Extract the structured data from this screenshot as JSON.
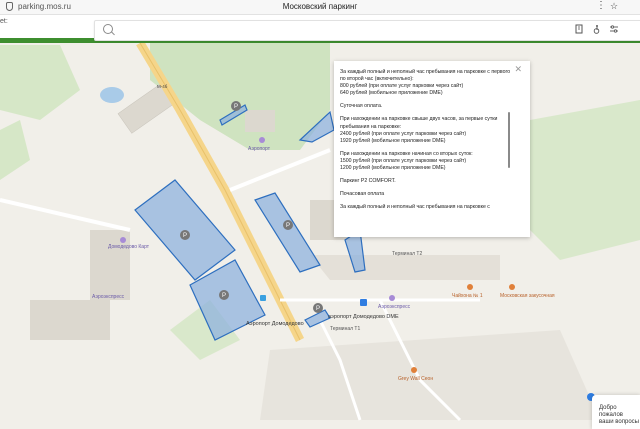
{
  "browser": {
    "url": "parking.mos.ru",
    "title": "Московский паркинг",
    "menu_glyph": "⋮",
    "star_glyph": "☆",
    "ext_text": "et:"
  },
  "search": {
    "placeholder": ""
  },
  "toolbar_icons": [
    "building-icon",
    "accessibility-icon",
    "filter-icon"
  ],
  "map_labels": {
    "domodedovo_karta": "Домодедово Карт",
    "aeroexpress_left": "Аэроэкспресс",
    "aeroport_domodedovo": "Аэропорт Домодедово",
    "aeroport_domodedovo_dme": "аэропорт Домодедово DME",
    "terminal_t1": "Терминал Т1",
    "terminal_t2": "Терминал Т2",
    "aeroexpress_right": "Аэроэкспресс",
    "chaykhona": "Чайхона № 1",
    "moskovskaya": "Московская закусочная",
    "grey_wall": "Grey Wall Сеон",
    "aeroport_top": "Аэропорт",
    "road_m4": "М-4б"
  },
  "popup": {
    "paragraphs": [
      [
        "За каждый полный и неполный час пребывания на парковке с первого по второй час (включительно):",
        "800 рублей (при оплате услуг парковки через сайт)",
        "640 рублей (мобильное приложение DME)"
      ],
      [
        "Суточная оплата."
      ],
      [
        "При нахождении на парковке свыше двух часов, за первые сутки пребывания на парковке:",
        "2400 рублей (при оплате услуг парковки через сайт)",
        "1920 рублей (мобильное приложение DME)"
      ],
      [
        "При нахождении на парковке начиная со вторых суток:",
        "1500 рублей (при оплате услуг парковки через сайт)",
        "1200 рублей (мобильное приложение DME)"
      ],
      [
        "Паркинг P2 COMFORT."
      ],
      [
        "Почасовая оплата"
      ],
      [
        "За каждый полный и неполный час пребывания на парковке с"
      ]
    ],
    "close_glyph": "✕"
  },
  "chat": {
    "line1": "Добро пожалов",
    "line2": "ваши вопросы"
  },
  "colors": {
    "accent_green": "#3e8e2f",
    "parking_fill": "#8fb3de",
    "parking_stroke": "#2e6fbf"
  }
}
